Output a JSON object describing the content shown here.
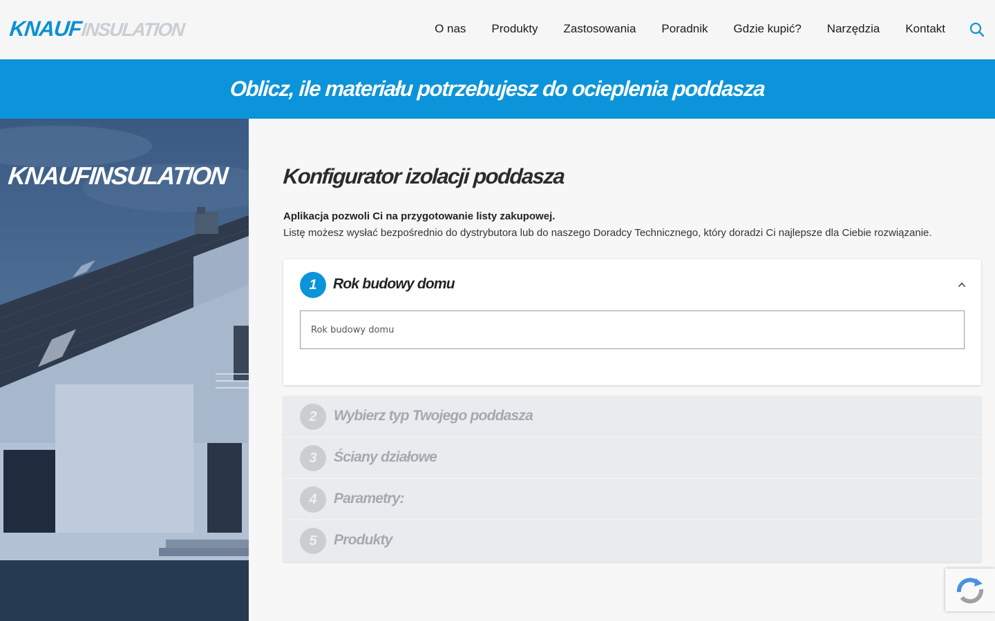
{
  "header": {
    "logo_primary": "KNAUF",
    "logo_secondary": "INSULATION",
    "nav": [
      "O nas",
      "Produkty",
      "Zastosowania",
      "Poradnik",
      "Gdzie kupić?",
      "Narzędzia",
      "Kontakt"
    ]
  },
  "banner": {
    "text": "Oblicz, ile materiału potrzebujesz do ocieplenia poddasza"
  },
  "hero": {
    "logo_text": "KNAUFINSULATION"
  },
  "main": {
    "title": "Konfigurator izolacji poddasza",
    "intro_bold": "Aplikacja pozwoli Ci na przygotowanie listy zakupowej.",
    "intro": "Listę możesz wysłać bezpośrednio do dystrybutora lub do naszego Doradcy Technicznego, który doradzi Ci najlepsze dla Ciebie rozwiązanie.",
    "active_step": {
      "number": "1",
      "title": "Rok budowy domu",
      "field_placeholder": "Rok budowy domu"
    },
    "steps": [
      {
        "number": "2",
        "label": "Wybierz typ Twojego poddasza"
      },
      {
        "number": "3",
        "label": "Ściany działowe"
      },
      {
        "number": "4",
        "label": "Parametry:"
      },
      {
        "number": "5",
        "label": "Produkty"
      }
    ]
  },
  "colors": {
    "brand": "#0b94d9",
    "inactive": "#a5a9ae"
  }
}
